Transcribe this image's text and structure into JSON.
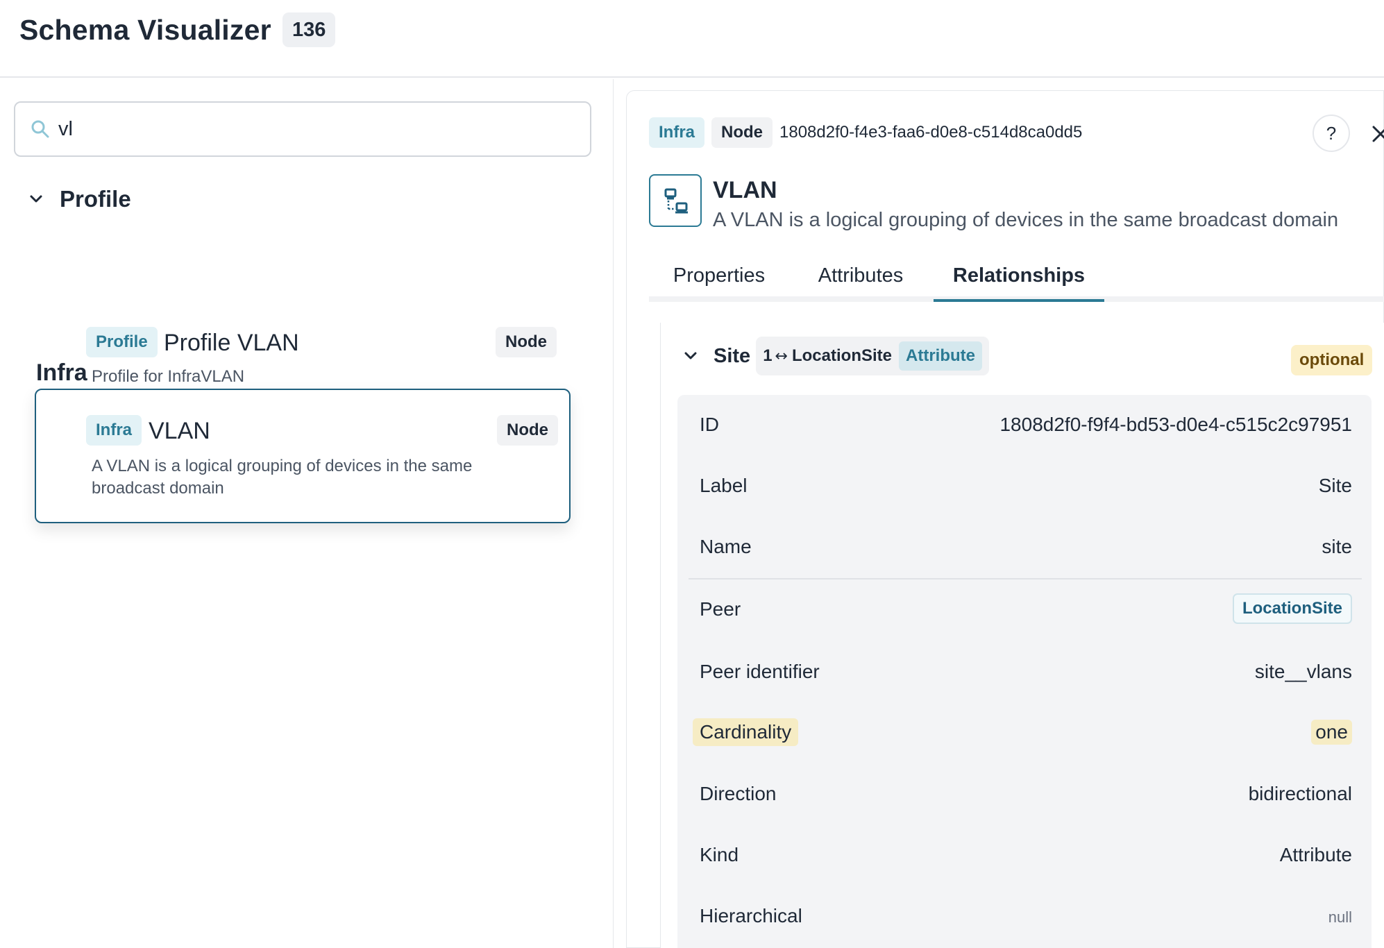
{
  "header": {
    "title": "Schema Visualizer",
    "count": "136"
  },
  "search": {
    "value": "vl",
    "placeholder": ""
  },
  "groups": {
    "profile": {
      "label": "Profile",
      "items": [
        {
          "namespace": "Profile",
          "title": "Profile VLAN",
          "kind": "Node",
          "description": "Profile for InfraVLAN"
        }
      ]
    },
    "infra": {
      "label": "Infra",
      "items": [
        {
          "namespace": "Infra",
          "title": "VLAN",
          "kind": "Node",
          "description": "A VLAN is a logical grouping of devices in the same broadcast domain"
        }
      ]
    }
  },
  "detail": {
    "namespace": "Infra",
    "kind": "Node",
    "uuid": "1808d2f0-f4e3-faa6-d0e8-c514d8ca0dd5",
    "help_label": "?",
    "name": "VLAN",
    "description": "A VLAN is a logical grouping of devices in the same broadcast domain",
    "icon": "network-icon",
    "tabs": [
      "Properties",
      "Attributes",
      "Relationships"
    ],
    "active_tab": "Relationships",
    "relationship": {
      "name": "Site",
      "cardinality_short": "1",
      "arrow": "↔",
      "peer": "LocationSite",
      "kind_badge": "Attribute",
      "optional_badge": "optional",
      "properties": [
        {
          "key": "ID",
          "value": "1808d2f0-f9f4-bd53-d0e4-c515c2c97951"
        },
        {
          "key": "Label",
          "value": "Site"
        },
        {
          "key": "Name",
          "value": "site"
        },
        {
          "key": "Peer",
          "value": "LocationSite"
        },
        {
          "key": "Peer identifier",
          "value": "site__vlans"
        },
        {
          "key": "Cardinality",
          "value": "one"
        },
        {
          "key": "Direction",
          "value": "bidirectional"
        },
        {
          "key": "Kind",
          "value": "Attribute"
        },
        {
          "key": "Hierarchical",
          "value": "null"
        }
      ]
    }
  },
  "colors": {
    "accent": "#2b7a94",
    "accent_dark": "#1e5f7e",
    "namespace_badge_bg": "#e3f2f6",
    "highlight": "#f6ecc4",
    "optional_badge_bg": "#fcf0c9"
  }
}
